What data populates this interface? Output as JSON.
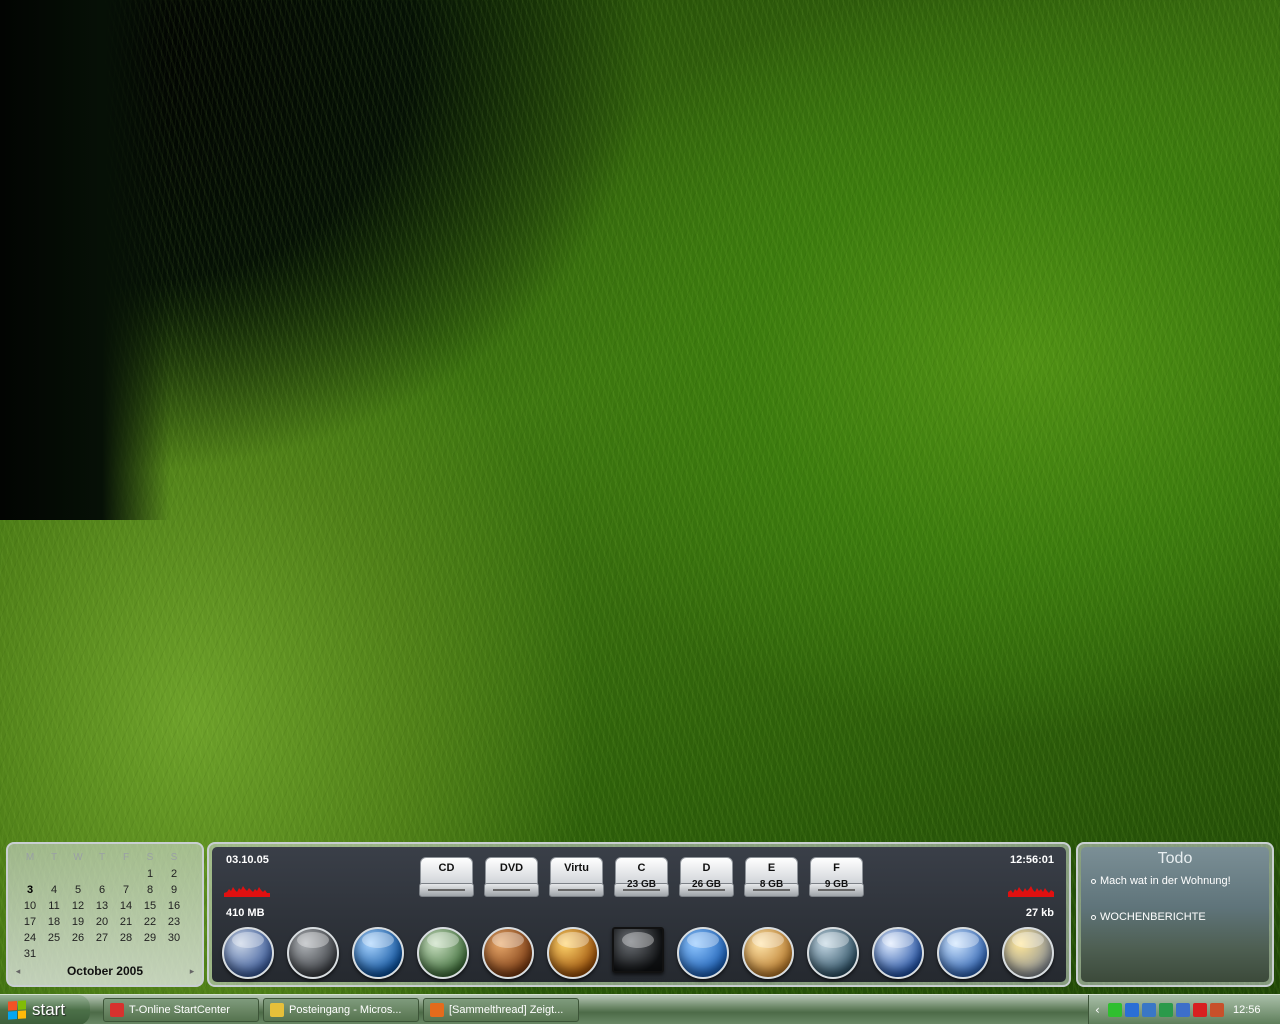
{
  "calendar": {
    "weekdays": [
      "M",
      "T",
      "W",
      "T",
      "F",
      "S",
      "S"
    ],
    "days": [
      "",
      "",
      "",
      "",
      "",
      "1",
      "2",
      "3",
      "4",
      "5",
      "6",
      "7",
      "8",
      "9",
      "10",
      "11",
      "12",
      "13",
      "14",
      "15",
      "16",
      "17",
      "18",
      "19",
      "20",
      "21",
      "22",
      "23",
      "24",
      "25",
      "26",
      "27",
      "28",
      "29",
      "30",
      "31"
    ],
    "today": "3",
    "month_label": "October 2005",
    "prev": "◂",
    "next": "▸"
  },
  "dock": {
    "date": "03.10.05",
    "time": "12:56:01",
    "memory": "410 MB",
    "network": "27 kb",
    "graph_color": "#e01010",
    "drives": [
      {
        "label": "CD",
        "size": ""
      },
      {
        "label": "DVD",
        "size": ""
      },
      {
        "label": "Virtu",
        "size": ""
      },
      {
        "label": "C",
        "size": "23 GB"
      },
      {
        "label": "D",
        "size": "26 GB"
      },
      {
        "label": "E",
        "size": "8 GB"
      },
      {
        "label": "F",
        "size": "9 GB"
      }
    ],
    "apps": [
      {
        "name": "app-icon-1",
        "colors": [
          "#c8d4e6",
          "#3a5a9a"
        ]
      },
      {
        "name": "app-icon-2",
        "colors": [
          "#b0b4b8",
          "#3a3d42"
        ]
      },
      {
        "name": "app-icon-3",
        "colors": [
          "#a8d4ff",
          "#0a4f9c"
        ]
      },
      {
        "name": "app-icon-4",
        "colors": [
          "#c8dfc0",
          "#3f6e3a"
        ]
      },
      {
        "name": "app-icon-5",
        "colors": [
          "#e8a86a",
          "#7a3a12"
        ]
      },
      {
        "name": "app-icon-6",
        "colors": [
          "#ffd36a",
          "#9a4e08"
        ]
      },
      {
        "name": "monitor-icon",
        "colors": [
          "#6b6f74",
          "#101214"
        ]
      },
      {
        "name": "icq-icon",
        "colors": [
          "#8fc6ff",
          "#1a5eb5"
        ]
      },
      {
        "name": "app-icon-9",
        "colors": [
          "#ffe4a8",
          "#b8792a"
        ]
      },
      {
        "name": "app-icon-10",
        "colors": [
          "#c4d8e4",
          "#2c4f63"
        ]
      },
      {
        "name": "app-icon-11",
        "colors": [
          "#e0ecff",
          "#1f4fa3"
        ]
      },
      {
        "name": "app-icon-12",
        "colors": [
          "#cfe6ff",
          "#2d62b3"
        ]
      },
      {
        "name": "app-icon-13",
        "colors": [
          "#ffe79a",
          "#8a8f94"
        ]
      }
    ]
  },
  "todo": {
    "title": "Todo",
    "items": [
      "Mach wat in der Wohnung!",
      "WOCHENBERICHTE"
    ]
  },
  "taskbar": {
    "start_label": "start",
    "tasks": [
      {
        "label": "T-Online StartCenter",
        "color": "#d7322e"
      },
      {
        "label": "Posteingang - Micros...",
        "color": "#e6c03a"
      },
      {
        "label": "[Sammelthread] Zeigt...",
        "color": "#e46b1c"
      }
    ],
    "tray_icons": [
      "#2fbf2f",
      "#2a6fd6",
      "#3a77c6",
      "#2a9a4a",
      "#3d6fc9",
      "#d82020",
      "#c8502a"
    ],
    "clock": "12:56"
  }
}
